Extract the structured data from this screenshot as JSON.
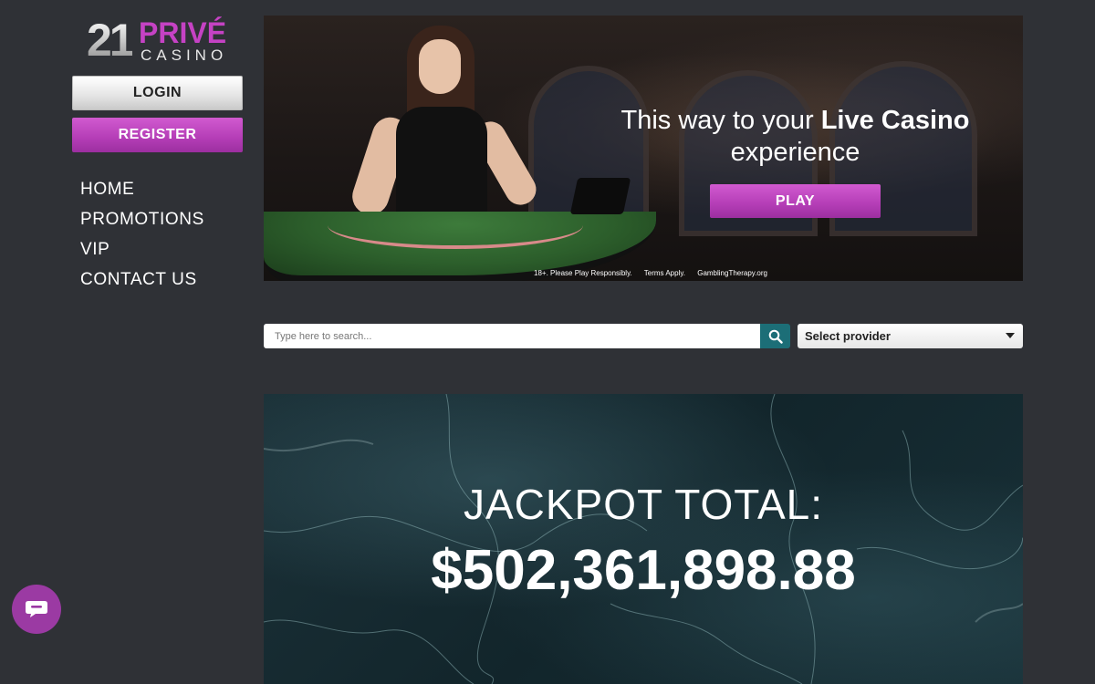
{
  "brand": {
    "logo_number": "21",
    "logo_word": "PRIVÉ",
    "logo_sub": "CASINO"
  },
  "auth": {
    "login_label": "LOGIN",
    "register_label": "REGISTER"
  },
  "nav": {
    "items": [
      {
        "label": "HOME"
      },
      {
        "label": "PROMOTIONS"
      },
      {
        "label": "VIP"
      },
      {
        "label": "CONTACT US"
      }
    ]
  },
  "hero": {
    "headline_pre": "This way to your ",
    "headline_bold": "Live Casino",
    "headline_post": "experience",
    "play_label": "PLAY",
    "disclaimer": [
      "18+. Please Play Responsibly.",
      "Terms Apply.",
      "GamblingTherapy.org"
    ]
  },
  "search": {
    "placeholder": "Type here to search...",
    "value": "",
    "icon": "search-icon"
  },
  "provider_select": {
    "selected": "Select provider"
  },
  "jackpot": {
    "title": "JACKPOT TOTAL:",
    "amount": "$502,361,898.88"
  },
  "chat": {
    "icon": "chat-bubble-icon"
  },
  "colors": {
    "accent": "#b43db6",
    "background": "#2f3136",
    "search_button": "#1c6e77"
  }
}
